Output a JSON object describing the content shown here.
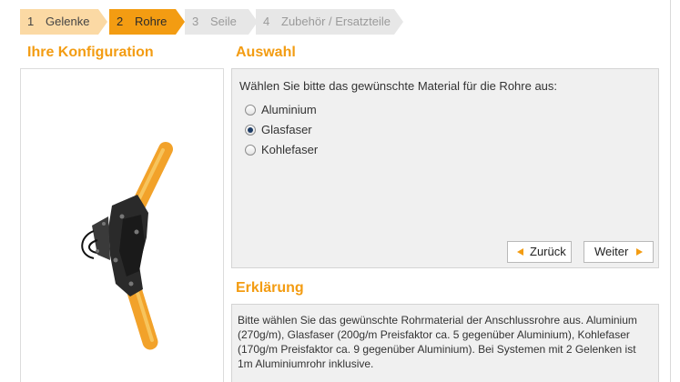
{
  "steps": [
    {
      "num": "1",
      "label": "Gelenke"
    },
    {
      "num": "2",
      "label": "Rohre"
    },
    {
      "num": "3",
      "label": "Seile"
    },
    {
      "num": "4",
      "label": "Zubehör / Ersatzteile"
    }
  ],
  "config": {
    "heading": "Ihre Konfiguration"
  },
  "auswahl": {
    "heading": "Auswahl",
    "prompt": "Wählen Sie bitte das gewünschte Material für die Rohre aus:",
    "options": [
      {
        "label": "Aluminium",
        "checked": false
      },
      {
        "label": "Glasfaser",
        "checked": true
      },
      {
        "label": "Kohlefaser",
        "checked": false
      }
    ],
    "back_label": "Zurück",
    "next_label": "Weiter"
  },
  "erklaerung": {
    "heading": "Erklärung",
    "text": "Bitte wählen Sie das gewünschte Rohrmaterial der Anschlussrohre aus. Aluminium (270g/m), Glasfaser (200g/m Preisfaktor ca. 5 gegenüber Aluminium), Kohlefaser (170g/m Preisfaktor ca. 9 gegenüber Aluminium). Bei Systemen mit 2 Gelenken ist 1m Aluminiumrohr inklusive."
  },
  "colors": {
    "accent": "#f39c12",
    "step_done": "#fbd9a4",
    "step_inactive": "#e7e7e7",
    "panel_bg": "#f0f0f0"
  }
}
